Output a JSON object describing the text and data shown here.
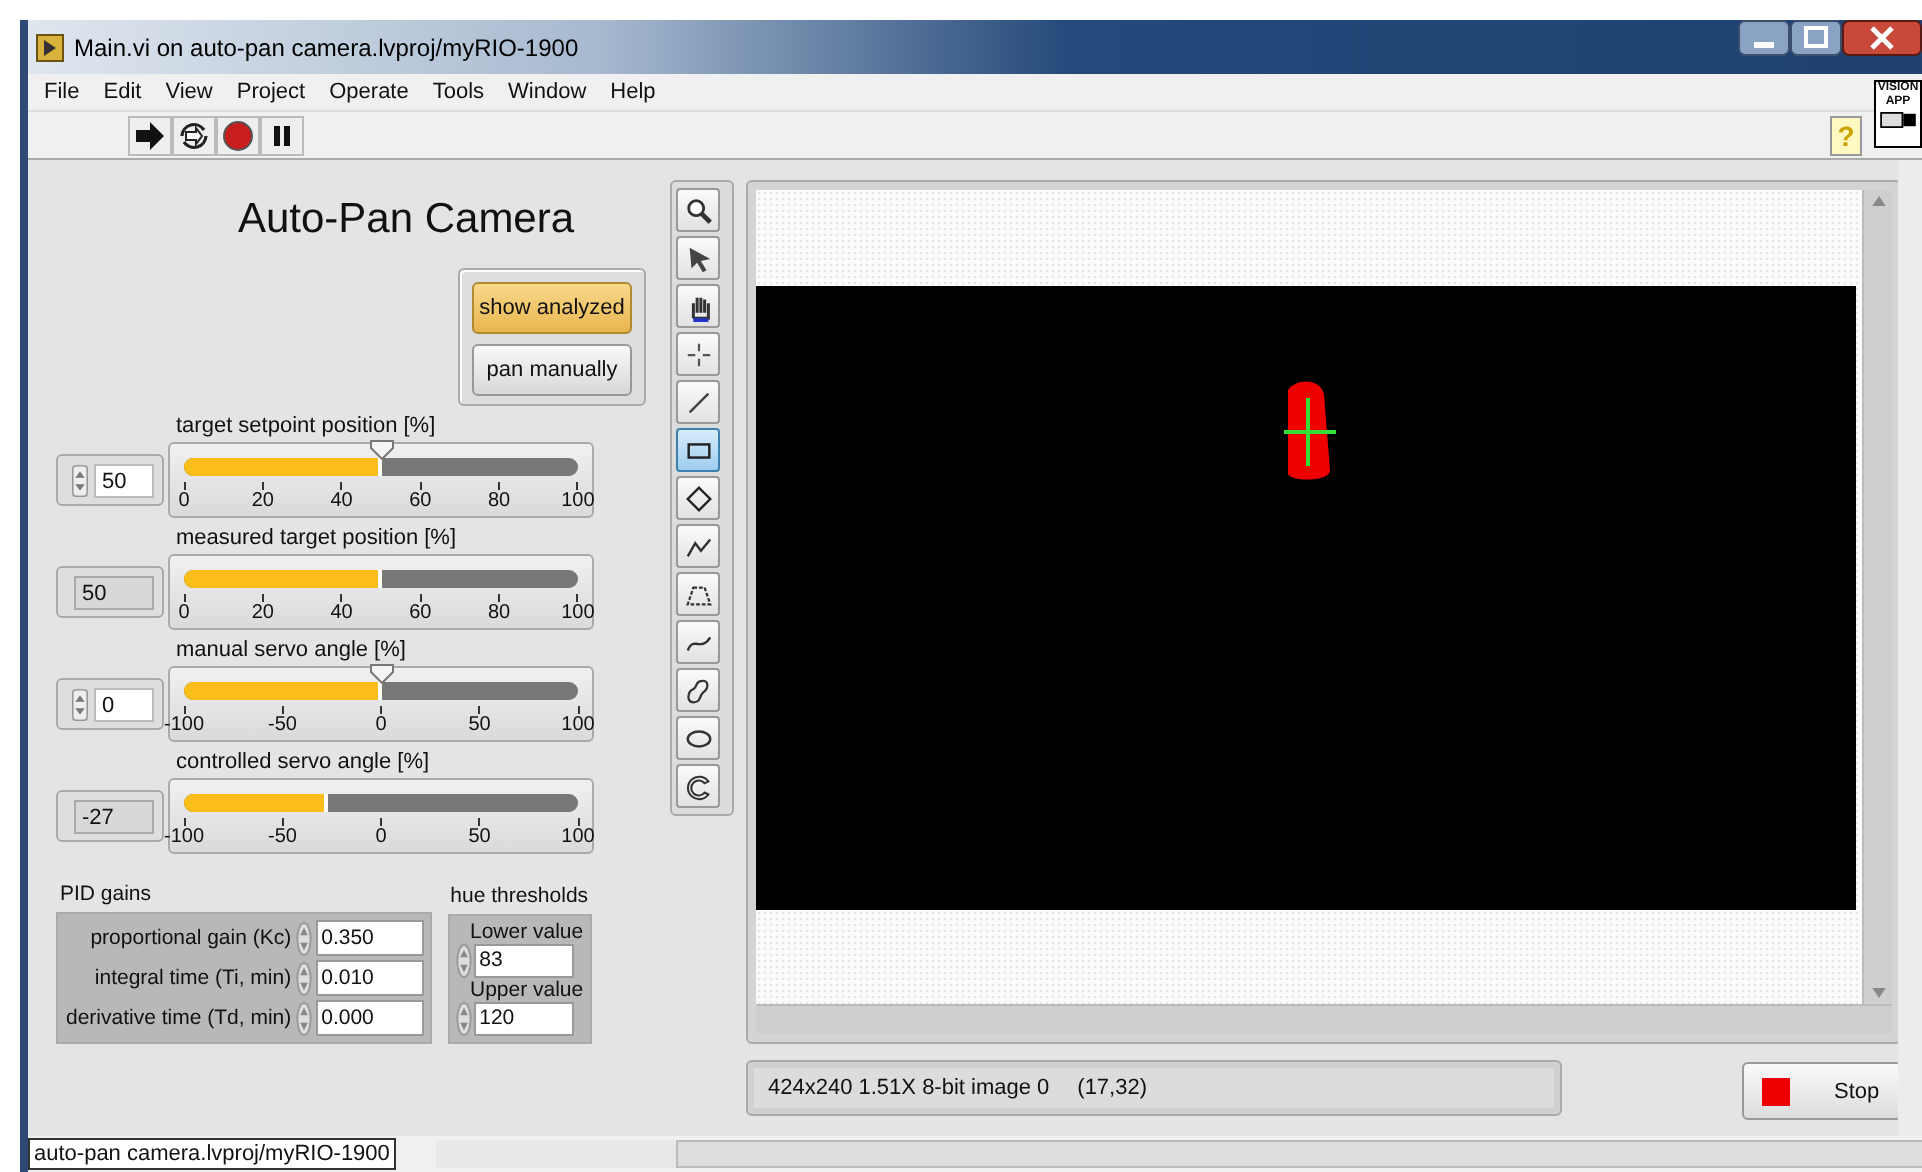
{
  "window": {
    "title": "Main.vi on auto-pan camera.lvproj/myRIO-1900"
  },
  "menu": [
    "File",
    "Edit",
    "View",
    "Project",
    "Operate",
    "Tools",
    "Window",
    "Help"
  ],
  "toolbar": {
    "help": "?",
    "logo": [
      "VISION",
      "APP"
    ]
  },
  "panel": {
    "title": "Auto-Pan Camera",
    "mode_buttons": [
      {
        "label": "show analyzed",
        "selected": true
      },
      {
        "label": "pan manually",
        "selected": false
      }
    ],
    "sliders": [
      {
        "label": "target setpoint position [%]",
        "kind": "control",
        "value": "50",
        "level": 0.5,
        "ticks": [
          "0",
          "20",
          "40",
          "60",
          "80",
          "100"
        ]
      },
      {
        "label": "measured target position [%]",
        "kind": "indicator",
        "value": "50",
        "level": 0.5,
        "ticks": [
          "0",
          "20",
          "40",
          "60",
          "80",
          "100"
        ]
      },
      {
        "label": "manual servo angle [%]",
        "kind": "control",
        "value": "0",
        "level": 0.5,
        "ticks": [
          "-100",
          "-50",
          "0",
          "50",
          "100"
        ]
      },
      {
        "label": "controlled servo angle [%]",
        "kind": "indicator",
        "value": "-27",
        "level": 0.365,
        "ticks": [
          "-100",
          "-50",
          "0",
          "50",
          "100"
        ]
      }
    ],
    "pid": {
      "title": "PID gains",
      "rows": [
        {
          "label": "proportional gain (Kc)",
          "value": "0.350"
        },
        {
          "label": "integral time (Ti, min)",
          "value": "0.010"
        },
        {
          "label": "derivative time (Td, min)",
          "value": "0.000"
        }
      ]
    },
    "hue": {
      "title": "hue thresholds",
      "rows": [
        {
          "label": "Lower value",
          "value": "83"
        },
        {
          "label": "Upper value",
          "value": "120"
        }
      ]
    }
  },
  "tools": [
    {
      "kind": "zoom",
      "selected": false
    },
    {
      "kind": "pointer",
      "selected": false
    },
    {
      "kind": "pan",
      "selected": false
    },
    {
      "kind": "point",
      "selected": false
    },
    {
      "kind": "line",
      "selected": false
    },
    {
      "kind": "rectangle",
      "selected": true
    },
    {
      "kind": "rotated",
      "selected": false
    },
    {
      "kind": "polyline",
      "selected": false
    },
    {
      "kind": "polygon",
      "selected": false
    },
    {
      "kind": "freehand",
      "selected": false
    },
    {
      "kind": "freeform",
      "selected": false
    },
    {
      "kind": "ellipse",
      "selected": false
    },
    {
      "kind": "annulus",
      "selected": false
    }
  ],
  "image_display": {
    "info": "424x240 1.51X 8-bit image 0",
    "coords": "(17,32)"
  },
  "stop_button": {
    "label": "Stop"
  },
  "status_bar": {
    "path": "auto-pan camera.lvproj/myRIO-1900"
  }
}
